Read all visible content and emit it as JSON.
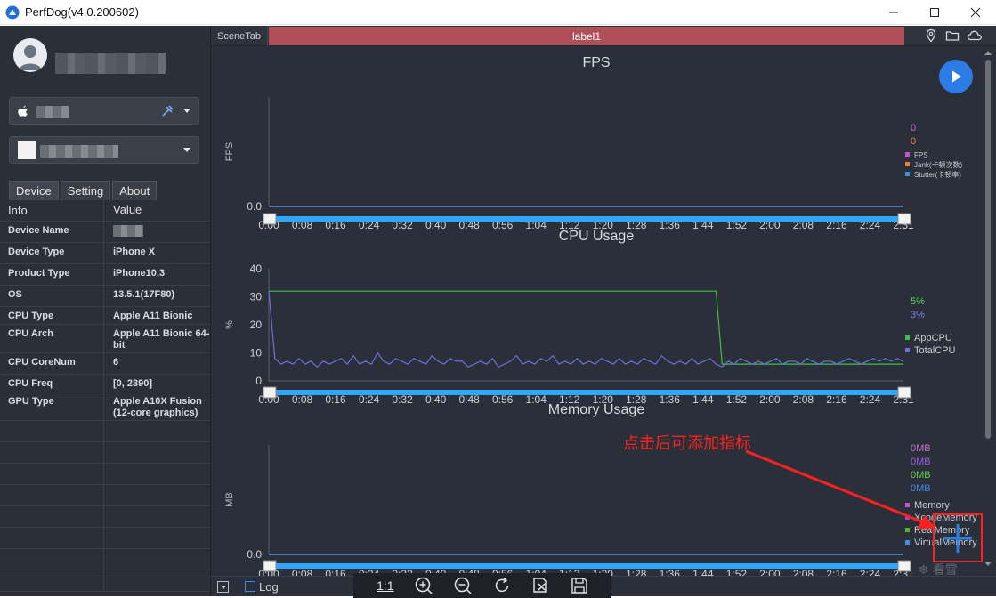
{
  "app": {
    "title": "PerfDog(v4.0.200602)"
  },
  "sidebar": {
    "tabs": [
      "Device",
      "Setting",
      "About"
    ],
    "table_header": {
      "key": "Info",
      "value": "Value"
    },
    "rows": [
      {
        "key": "Device Name",
        "value": ""
      },
      {
        "key": "Device Type",
        "value": "iPhone X"
      },
      {
        "key": "Product Type",
        "value": "iPhone10,3"
      },
      {
        "key": "OS",
        "value": "13.5.1(17F80)"
      },
      {
        "key": "CPU Type",
        "value": "Apple A11 Bionic"
      },
      {
        "key": "CPU Arch",
        "value": "Apple A11 Bionic 64-bit"
      },
      {
        "key": "CPU CoreNum",
        "value": "6"
      },
      {
        "key": "CPU Freq",
        "value": "[0, 2390]"
      },
      {
        "key": "GPU Type",
        "value": "Apple A10X Fusion (12-core graphics)"
      }
    ]
  },
  "scene": {
    "tab": "SceneTab",
    "label": "label1"
  },
  "bottom": {
    "log_label": "Log",
    "zoom_label": "1:1"
  },
  "annotation": {
    "text": "点击后可添加指标"
  },
  "watermark": "看雪",
  "chart_data": [
    {
      "type": "line",
      "title": "FPS",
      "ylabel": "FPS",
      "yticks": [
        "0.0"
      ],
      "xticks": [
        "0:00",
        "0:08",
        "0:16",
        "0:24",
        "0:32",
        "0:40",
        "0:48",
        "0:56",
        "1:04",
        "1:12",
        "1:20",
        "1:28",
        "1:36",
        "1:44",
        "1:52",
        "2:00",
        "2:08",
        "2:16",
        "2:24",
        "2:31"
      ],
      "legend_values": [
        {
          "text": "0",
          "color": "#c86fd0"
        },
        {
          "text": "0",
          "color": "#e8813a"
        }
      ],
      "series": [
        {
          "name": "FPS",
          "color": "#c056c9",
          "values": [
            0,
            0
          ]
        },
        {
          "name": "Jank(卡顿次数)",
          "color": "#e8813a",
          "values": [
            0,
            0
          ]
        },
        {
          "name": "Stutter(卡顿率)",
          "color": "#3f8ee8",
          "values": [
            0,
            0
          ]
        }
      ]
    },
    {
      "type": "line",
      "title": "CPU Usage",
      "ylabel": "%",
      "ylim": [
        0,
        40
      ],
      "yticks": [
        "0",
        "10",
        "20",
        "30",
        "40"
      ],
      "xticks": [
        "0:00",
        "0:08",
        "0:16",
        "0:24",
        "0:32",
        "0:40",
        "0:48",
        "0:56",
        "1:04",
        "1:12",
        "1:20",
        "1:28",
        "1:36",
        "1:44",
        "1:52",
        "2:00",
        "2:08",
        "2:16",
        "2:24",
        "2:31"
      ],
      "legend_values": [
        {
          "text": "5%",
          "color": "#5fd66a"
        },
        {
          "text": "3%",
          "color": "#7a7fe0"
        }
      ],
      "series": [
        {
          "name": "AppCPU",
          "color": "#3fbf4a",
          "values": [
            32,
            32,
            32,
            32,
            32,
            32,
            32,
            32,
            32,
            32,
            32,
            32,
            32,
            32,
            32,
            32,
            32,
            32,
            32,
            32,
            32,
            32,
            32,
            32,
            32,
            32,
            32,
            32,
            32,
            32,
            32,
            32,
            32,
            32,
            32,
            32,
            32,
            32,
            32,
            32,
            32,
            32,
            32,
            32,
            32,
            32,
            32,
            32,
            32,
            32,
            32,
            32,
            32,
            32,
            32,
            32,
            32,
            32,
            32,
            32,
            32,
            32,
            32,
            32,
            32,
            32,
            32,
            32,
            32,
            32,
            32,
            32,
            32,
            32,
            32,
            6,
            6,
            6,
            6,
            6,
            6,
            6,
            6,
            6,
            6,
            6,
            6,
            6,
            6,
            6,
            6,
            6,
            6,
            6,
            6,
            6,
            6,
            6,
            6,
            6,
            6,
            6,
            6,
            6,
            6,
            6
          ]
        },
        {
          "name": "TotalCPU",
          "color": "#6b70d8",
          "values": [
            32,
            8,
            6,
            7,
            6,
            8,
            6,
            7,
            5,
            7,
            6,
            7,
            8,
            6,
            9,
            6,
            7,
            6,
            10,
            7,
            6,
            8,
            7,
            6,
            8,
            7,
            6,
            9,
            7,
            6,
            8,
            7,
            7,
            5,
            6,
            7,
            6,
            8,
            5,
            6,
            7,
            9,
            6,
            7,
            6,
            8,
            7,
            9,
            6,
            7,
            6,
            8,
            6,
            7,
            6,
            8,
            7,
            6,
            8,
            6,
            7,
            6,
            8,
            7,
            6,
            9,
            7,
            6,
            7,
            6,
            8,
            6,
            7,
            8,
            6,
            5,
            7,
            6,
            8,
            7,
            6,
            7,
            6,
            7,
            8,
            6,
            7,
            7,
            6,
            8,
            7,
            6,
            7,
            7,
            6,
            7,
            8,
            7,
            6,
            7,
            8,
            7,
            8,
            7,
            8,
            7
          ]
        }
      ]
    },
    {
      "type": "line",
      "title": "Memory Usage",
      "ylabel": "MB",
      "yticks": [
        "0.0"
      ],
      "xticks": [
        "0:00",
        "0:08",
        "0:16",
        "0:24",
        "0:32",
        "0:40",
        "0:48",
        "0:56",
        "1:04",
        "1:12",
        "1:20",
        "1:28",
        "1:36",
        "1:44",
        "1:52",
        "2:00",
        "2:08",
        "2:16",
        "2:24",
        "2:31"
      ],
      "legend_values": [
        {
          "text": "0MB",
          "color": "#c86fd0"
        },
        {
          "text": "0MB",
          "color": "#9a5fe0"
        },
        {
          "text": "0MB",
          "color": "#6ccf4a"
        },
        {
          "text": "0MB",
          "color": "#4a8ce8"
        }
      ],
      "series": [
        {
          "name": "Memory",
          "color": "#c056c9",
          "values": [
            0,
            0
          ]
        },
        {
          "name": "XcodeMemory",
          "color": "#8a4fd8",
          "values": [
            0,
            0
          ]
        },
        {
          "name": "RealMemory",
          "color": "#4cb530",
          "values": [
            0,
            0
          ]
        },
        {
          "name": "VirtualMemory",
          "color": "#3f8ee8",
          "values": [
            0,
            0
          ]
        }
      ]
    }
  ]
}
